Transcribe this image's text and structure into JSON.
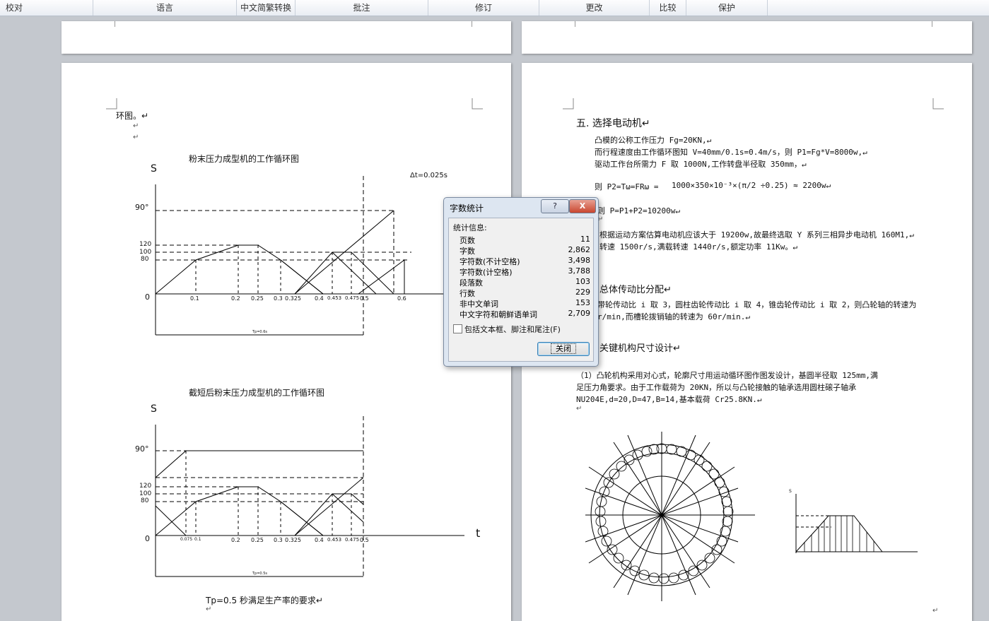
{
  "ribbon": {
    "tabs": [
      "校对",
      "语言",
      "中文简繁转换",
      "批注",
      "修订",
      "更改",
      "比较",
      "保护"
    ]
  },
  "left_page": {
    "line1": "环图。↵",
    "ret": "↵",
    "chart1_title": "粉末压力成型机的工作循环图",
    "chart1_note": "Δt=0.025s",
    "axis_s": "S",
    "y_labels": [
      "90°",
      "120",
      "100",
      "80",
      "0"
    ],
    "x_labels1": [
      "0.1",
      "0.2",
      "0.25",
      "0.3",
      "0.325",
      "0.4",
      "0.453",
      "0.475",
      "0.5",
      "0.6"
    ],
    "tp1": "Tp=0.6s",
    "chart2_title": "截短后粉末压力成型机的工作循环图",
    "x_labels2": [
      "0.075",
      "0.1",
      "0.2",
      "0.25",
      "0.3",
      "0.325",
      "0.4",
      "0.453",
      "0.475",
      "0.5"
    ],
    "axis_t": "t",
    "tp2": "Tp=0.5s",
    "bottom_line": "Tp=0.5 秒满足生产率的要求↵"
  },
  "right_page": {
    "heading5": "五. 选择电动机↵",
    "p1": "凸模的公称工作压力 Fg=20KN,↵",
    "p2": "而行程速度由工作循环图知 V=40mm/0.1s=0.4m/s，则 P1=Fg*V=8000w,↵",
    "p3": "驱动工作台所需力 F 取 1000N,工作转盘半径取 350mm，↵",
    "p4_prefix": "则 P2=Tω=FRω =",
    "p4_formula": "1000×350×10⁻³×(π/2 ÷0.25) ≈ 2200w↵",
    "p5": "则 P=P1+P2=10200w↵",
    "p6a": "根据运动方案估算电动机应该大于 19200w,故最终选取 Y 系列三相异步电动机 160M1,↵",
    "p6b": "转速 1500r/s,满载转速 1440r/s,额定功率 11Kw。↵",
    "heading6": "总体传动比分配↵",
    "p7a": "带轮传动比 i 取 3，圆柱齿轮传动比 i 取 4，锥齿轮传动比 i 取 2，则凸轮轴的转速为",
    "p7b": "r/min,而槽轮拨销轴的转速为 60r/min.↵",
    "heading7": "关键机构尺寸设计↵",
    "p8a": "（1）凸轮机构采用对心式，轮廓尺寸用运动循环图作图发设计，基圆半径取 125mm,满",
    "p8b": "足压力角要求。由于工作载荷为 20KN，所以与凸轮接触的轴承选用圆柱磙子轴承",
    "p8c": "NU204E,d=20,D=47,B=14,基本载荷 Cr25.8KN.↵",
    "ret": "↵",
    "small_s": "S"
  },
  "dialog": {
    "title": "字数统计",
    "help": "?",
    "close_x": "X",
    "section": "统计信息:",
    "rows": [
      {
        "label": "页数",
        "value": "11"
      },
      {
        "label": "字数",
        "value": "2,862"
      },
      {
        "label": "字符数(不计空格)",
        "value": "3,498"
      },
      {
        "label": "字符数(计空格)",
        "value": "3,788"
      },
      {
        "label": "段落数",
        "value": "103"
      },
      {
        "label": "行数",
        "value": "229"
      },
      {
        "label": "非中文单词",
        "value": "153"
      },
      {
        "label": "中文字符和朝鲜语单词",
        "value": "2,709"
      }
    ],
    "checkbox_label": "包括文本框、脚注和尾注(F)",
    "close_button": "关闭"
  }
}
